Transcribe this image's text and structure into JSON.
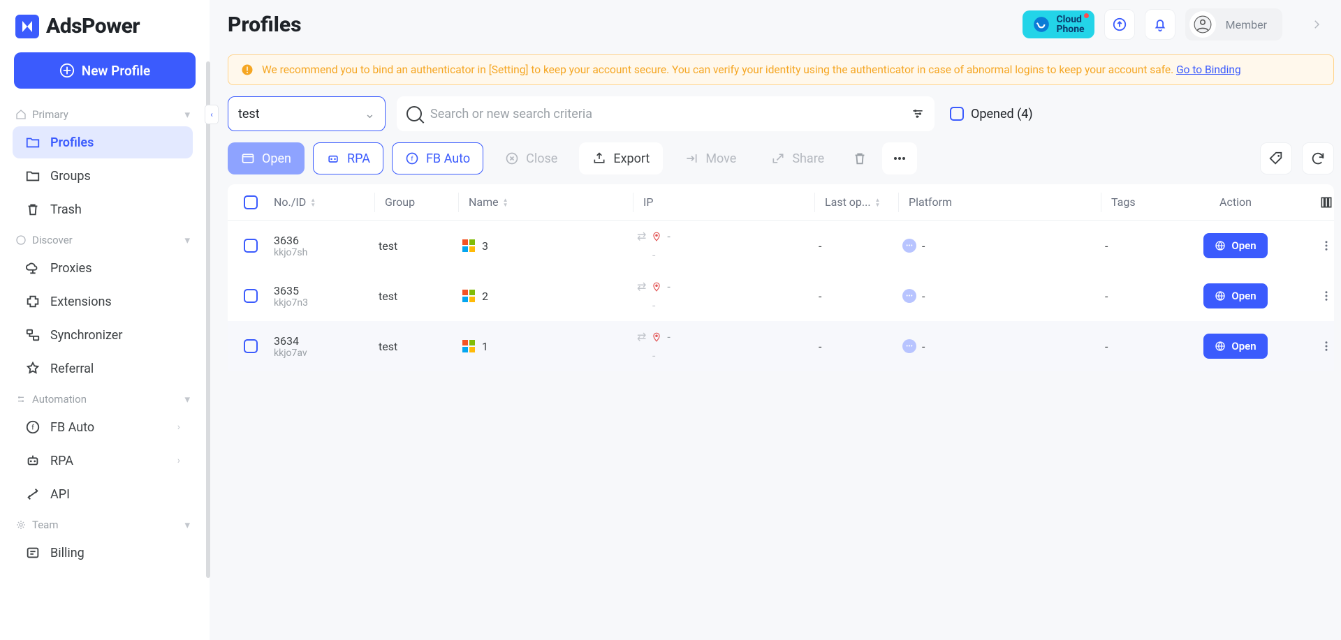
{
  "app": {
    "name": "AdsPower"
  },
  "header": {
    "title": "Profiles",
    "cloud_phone": "Cloud\nPhone",
    "member_label": "Member"
  },
  "sidebar": {
    "new_profile": "New Profile",
    "sections": [
      {
        "label": "Primary",
        "items": [
          {
            "key": "profiles",
            "label": "Profiles",
            "active": true
          },
          {
            "key": "groups",
            "label": "Groups"
          },
          {
            "key": "trash",
            "label": "Trash"
          }
        ]
      },
      {
        "label": "Discover",
        "items": [
          {
            "key": "proxies",
            "label": "Proxies"
          },
          {
            "key": "extensions",
            "label": "Extensions"
          },
          {
            "key": "synchronizer",
            "label": "Synchronizer"
          },
          {
            "key": "referral",
            "label": "Referral"
          }
        ]
      },
      {
        "label": "Automation",
        "items": [
          {
            "key": "fbauto",
            "label": "FB Auto",
            "chev": true
          },
          {
            "key": "rpa",
            "label": "RPA",
            "chev": true
          },
          {
            "key": "api",
            "label": "API"
          }
        ]
      },
      {
        "label": "Team",
        "items": [
          {
            "key": "billing",
            "label": "Billing"
          }
        ]
      }
    ]
  },
  "banner": {
    "text": "We recommend you to bind an authenticator in [Setting] to keep your account secure. You can verify your identity using the authenticator in case of abnormal logins to keep your account safe.",
    "link": "Go to Binding"
  },
  "filters": {
    "group_value": "test",
    "search_placeholder": "Search or new search criteria",
    "opened_label": "Opened (4)"
  },
  "toolbar": {
    "open": "Open",
    "rpa": "RPA",
    "fbauto": "FB Auto",
    "close": "Close",
    "export": "Export",
    "move": "Move",
    "share": "Share"
  },
  "table": {
    "columns": {
      "no": "No./ID",
      "group": "Group",
      "name": "Name",
      "ip": "IP",
      "lastop": "Last op...",
      "platform": "Platform",
      "tags": "Tags",
      "action": "Action"
    },
    "rows": [
      {
        "no": "3636",
        "id": "kkjo7sh",
        "group": "test",
        "name": "3",
        "ip": "-",
        "ip_sub": "-",
        "lastop": "-",
        "platform": "-",
        "tags": "-",
        "action": "Open"
      },
      {
        "no": "3635",
        "id": "kkjo7n3",
        "group": "test",
        "name": "2",
        "ip": "-",
        "ip_sub": "-",
        "lastop": "-",
        "platform": "-",
        "tags": "-",
        "action": "Open"
      },
      {
        "no": "3634",
        "id": "kkjo7av",
        "group": "test",
        "name": "1",
        "ip": "-",
        "ip_sub": "-",
        "lastop": "-",
        "platform": "-",
        "tags": "-",
        "action": "Open"
      }
    ]
  }
}
